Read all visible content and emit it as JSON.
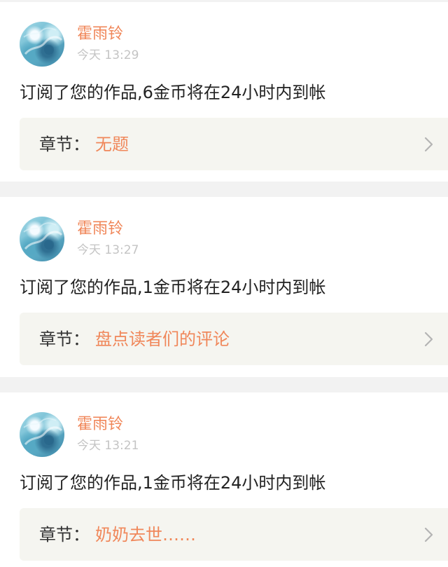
{
  "notifications": [
    {
      "username": "霍雨铃",
      "time": "今天 13:29",
      "message": "订阅了您的作品,6金币将在24小时内到帐",
      "chapter_label": "章节：",
      "chapter_title": "无题"
    },
    {
      "username": "霍雨铃",
      "time": "今天 13:27",
      "message": "订阅了您的作品,1金币将在24小时内到帐",
      "chapter_label": "章节：",
      "chapter_title": "盘点读者们的评论"
    },
    {
      "username": "霍雨铃",
      "time": "今天 13:21",
      "message": "订阅了您的作品,1金币将在24小时内到帐",
      "chapter_label": "章节：",
      "chapter_title": "奶奶去世……"
    }
  ],
  "icons": {
    "avatar": "user-avatar",
    "chapter_link": "chevron-right-icon"
  },
  "colors": {
    "accent": "#f0875a",
    "page_background": "#f2f2f2",
    "card_background": "#ffffff",
    "chapter_background": "#f5f5f0",
    "text_primary": "#222222",
    "text_secondary": "#c4c4c4"
  }
}
